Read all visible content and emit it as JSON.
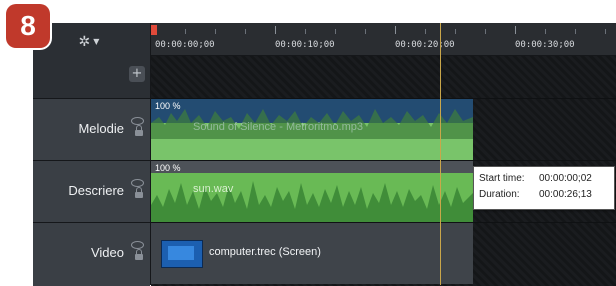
{
  "step_badge": "8",
  "toolbar": {
    "gear_icon": "gear-icon",
    "add_icon": "plus-icon",
    "add_label": "+"
  },
  "ruler": {
    "labels": [
      "00:00:00;00",
      "00:00:10;00",
      "00:00:20;00",
      "00:00:30;00"
    ]
  },
  "tracks": [
    {
      "name": "Melodie",
      "clip": {
        "percent": "100 %",
        "label": "Sound of Silence - Metroritmo.mp3"
      }
    },
    {
      "name": "Descriere",
      "clip": {
        "percent": "100 %",
        "label": "sun.wav"
      }
    },
    {
      "name": "Video",
      "clip": {
        "label": "computer.trec (Screen)"
      }
    }
  ],
  "tooltip": {
    "start_key": "Start time:",
    "start_val": "00:00:00;02",
    "duration_key": "Duration:",
    "duration_val": "00:00:26;13"
  },
  "colors": {
    "melodie_clip": "#79c46a",
    "melodie_band": "#234c72",
    "descriere_clip": "#69ba55",
    "badge": "#c0392b",
    "playhead": "#e04a3a"
  }
}
